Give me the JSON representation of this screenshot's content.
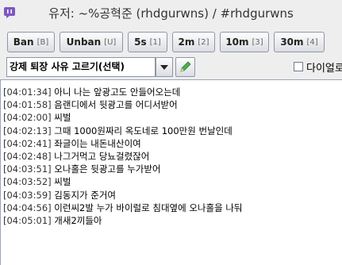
{
  "window": {
    "title": "유저: ~%공혁준 (rhdgurwns) / #rhdgurwns"
  },
  "toolbar": {
    "buttons": [
      {
        "label": "Ban",
        "hotkey": "[B]"
      },
      {
        "label": "Unban",
        "hotkey": "[U]"
      },
      {
        "label": "5s",
        "hotkey": "[1]"
      },
      {
        "label": "2m",
        "hotkey": "[2]"
      },
      {
        "label": "10m",
        "hotkey": "[3]"
      },
      {
        "label": "30m",
        "hotkey": "[4]"
      }
    ],
    "reason_select": {
      "value": "강제 퇴장 사유 고르기(선택)"
    },
    "checkbox": {
      "label": "다이얼로",
      "checked": false
    }
  },
  "log": {
    "lines": [
      {
        "time": "[04:01:34]",
        "text": "아니 나는 앞광고도 안들어오는데"
      },
      {
        "time": "[04:01:58]",
        "text": "음랜디에서 뒷광고를 어디서받어"
      },
      {
        "time": "[04:02:00]",
        "text": "씨벌"
      },
      {
        "time": "[04:02:13]",
        "text": "그때 1000원짜리 옥도네로 100만원 번날인데"
      },
      {
        "time": "[04:02:41]",
        "text": "좌글이는 내돈내산이여"
      },
      {
        "time": "[04:02:48]",
        "text": "나그거먹고 당뇨걸렸잖어"
      },
      {
        "time": "[04:03:51]",
        "text": "오나홀은 뒷광고를 누가받어"
      },
      {
        "time": "[04:03:52]",
        "text": "씨벌"
      },
      {
        "time": "[04:03:59]",
        "text": "김동지가 준거여"
      },
      {
        "time": "[04:04:56]",
        "text": "이런씨2발 누가 바이럴로 침대옆에 오나홀을 나둬"
      },
      {
        "time": "[04:05:01]",
        "text": "개새2끼들아"
      }
    ]
  }
}
